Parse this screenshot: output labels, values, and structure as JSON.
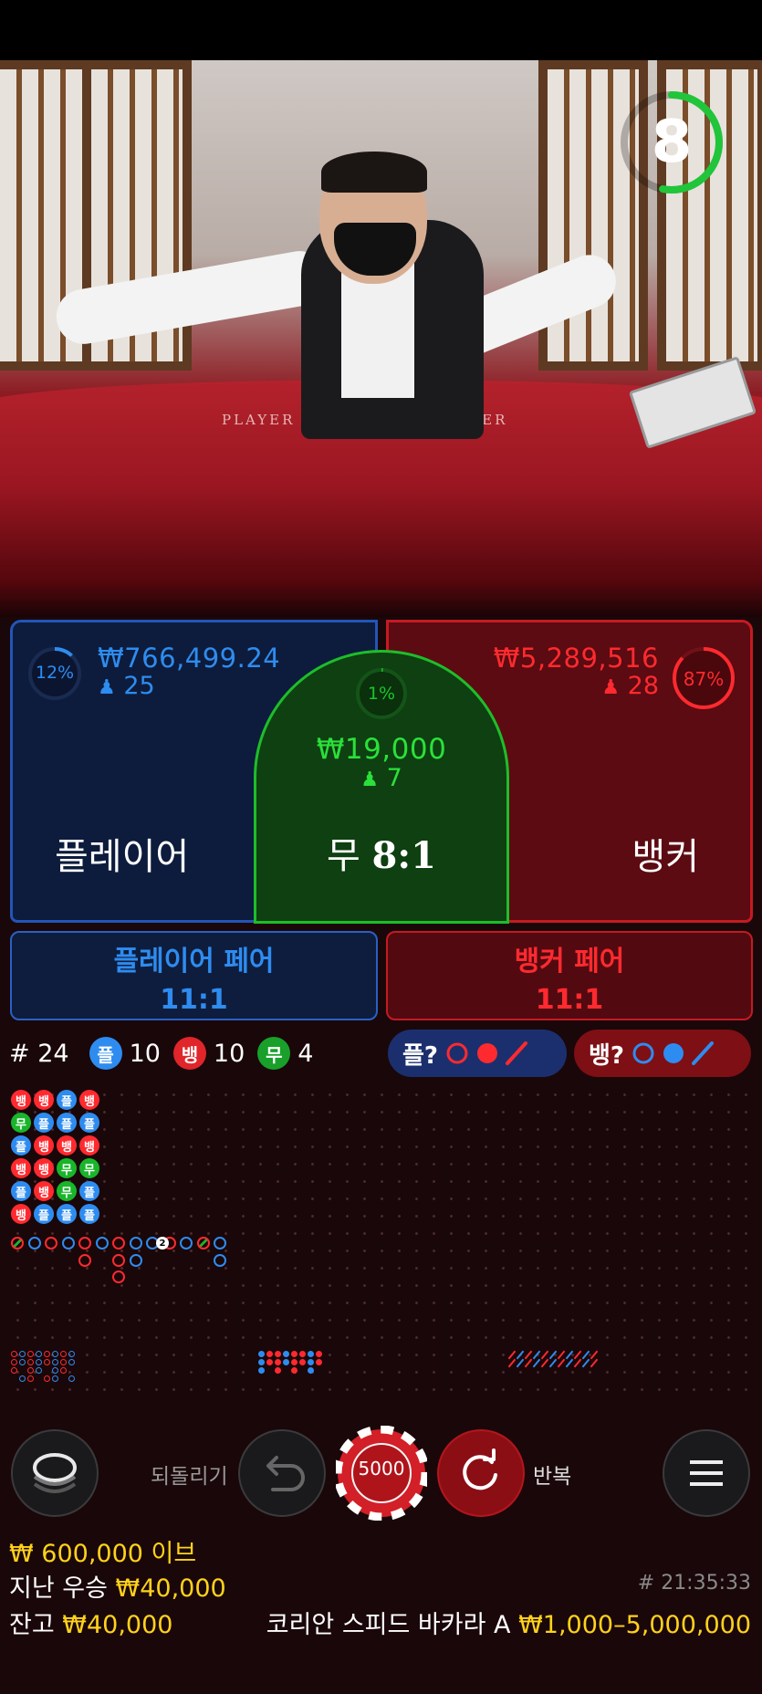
{
  "timer": {
    "value": "8",
    "progress": 0.53
  },
  "table_labels": {
    "player": "PLAYER",
    "banker": "BANKER"
  },
  "player": {
    "percent": "12%",
    "percent_value": 0.12,
    "amount": "₩766,499.24",
    "count": "25",
    "label": "플레이어"
  },
  "tie": {
    "percent": "1%",
    "percent_value": 0.01,
    "amount": "₩19,000",
    "count": "7",
    "label": "무",
    "odds": "8:1"
  },
  "banker": {
    "percent": "87%",
    "percent_value": 0.87,
    "amount": "₩5,289,516",
    "count": "28",
    "label": "뱅커"
  },
  "player_pair": {
    "label": "플레이어 페어",
    "odds": "11:1"
  },
  "banker_pair": {
    "label": "뱅커 페어",
    "odds": "11:1"
  },
  "stats": {
    "round": "# 24",
    "player_icon": "플",
    "player_count": "10",
    "banker_icon": "뱅",
    "banker_count": "10",
    "tie_icon": "무",
    "tie_count": "4"
  },
  "predict": {
    "player": "플?",
    "banker": "뱅?"
  },
  "bead_road": [
    [
      "뱅",
      "뱅",
      "플",
      "뱅"
    ],
    [
      "무",
      "플",
      "플",
      "플"
    ],
    [
      "플",
      "뱅",
      "뱅",
      "뱅"
    ],
    [
      "뱅",
      "뱅",
      "무",
      "무"
    ],
    [
      "플",
      "뱅",
      "무",
      "플"
    ],
    [
      "뱅",
      "플",
      "플",
      "플"
    ]
  ],
  "big_road_tie_mark": "2",
  "controls": {
    "undo_label": "되돌리기",
    "repeat_label": "반복",
    "chip_value": "5000"
  },
  "footer": {
    "bet_total": "₩ 600,000 이브",
    "last_win_label": "지난 우승",
    "last_win_amount": "₩40,000",
    "timestamp": "# 21:35:33",
    "balance_label": "잔고",
    "balance_amount": "₩40,000",
    "table_name": "코리안 스피드 바카라 A",
    "limits": "₩1,000–5,000,000"
  },
  "colors": {
    "player": "#2e8cf0",
    "banker": "#ff2a2f",
    "tie": "#19b52a",
    "gold": "#ffd21a"
  }
}
